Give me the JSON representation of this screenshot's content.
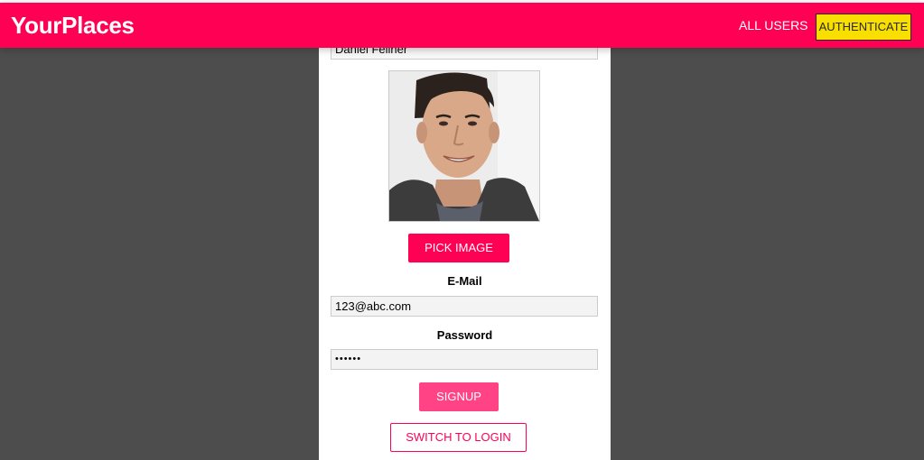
{
  "header": {
    "brand": "YourPlaces",
    "nav": {
      "all_users": "ALL USERS",
      "authenticate": "AUTHENTICATE"
    }
  },
  "form": {
    "name_value": "Daniel Fellner",
    "pick_image_label": "PICK IMAGE",
    "email_label": "E-Mail",
    "email_value": "123@abc.com",
    "password_label": "Password",
    "password_value": "••••••",
    "signup_label": "SIGNUP",
    "switch_label": "SWITCH TO LOGIN"
  },
  "colors": {
    "accent": "#ff0055",
    "authenticate_bg": "#f8df00",
    "backdrop": "#4d4d4d"
  }
}
